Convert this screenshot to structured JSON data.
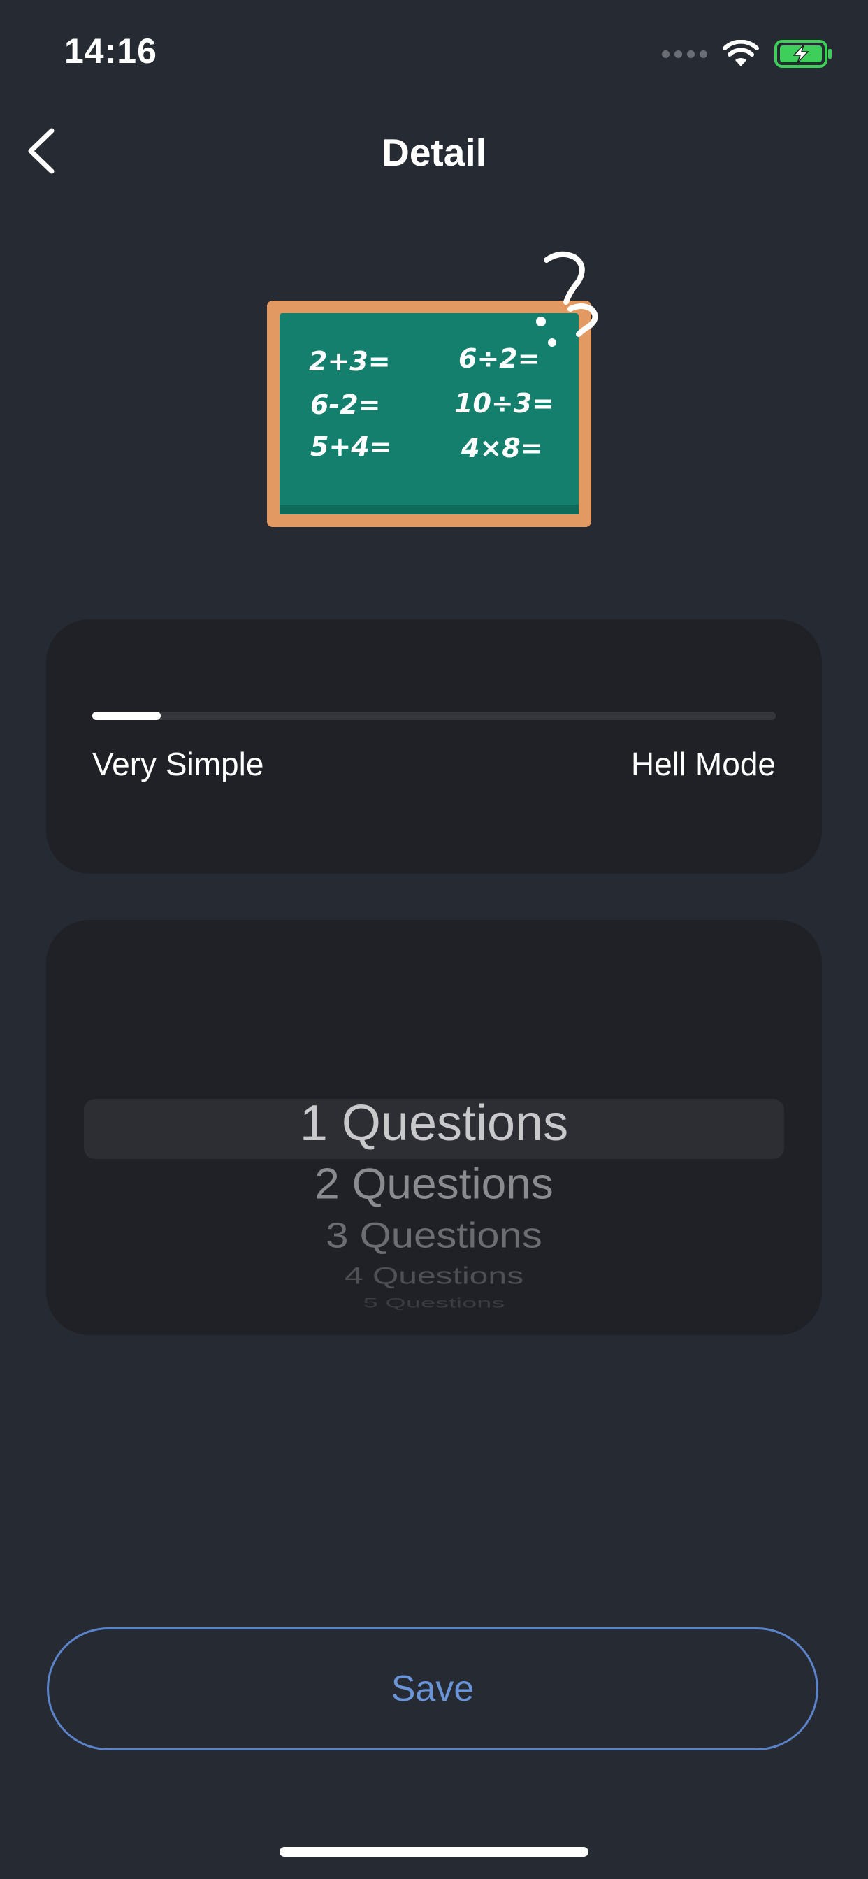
{
  "status_bar": {
    "time": "14:16",
    "battery_color": "#3ecf5a"
  },
  "nav": {
    "title": "Detail",
    "back_icon": "chevron-left-icon"
  },
  "illustration": {
    "icon": "chalkboard-math-icon",
    "equations": [
      "2+3=",
      "6÷2=",
      "6-2=",
      "10÷3=",
      "5+4=",
      "4×8="
    ],
    "board_color": "#137f6c",
    "frame_color": "#e39a62"
  },
  "difficulty": {
    "min_label": "Very Simple",
    "max_label": "Hell Mode",
    "value_fraction": 0.1
  },
  "question_picker": {
    "selected": "1 Questions",
    "options": [
      "1 Questions",
      "2 Questions",
      "3 Questions",
      "4 Questions",
      "5 Questions"
    ]
  },
  "actions": {
    "save_label": "Save",
    "accent": "#6a94d8"
  }
}
